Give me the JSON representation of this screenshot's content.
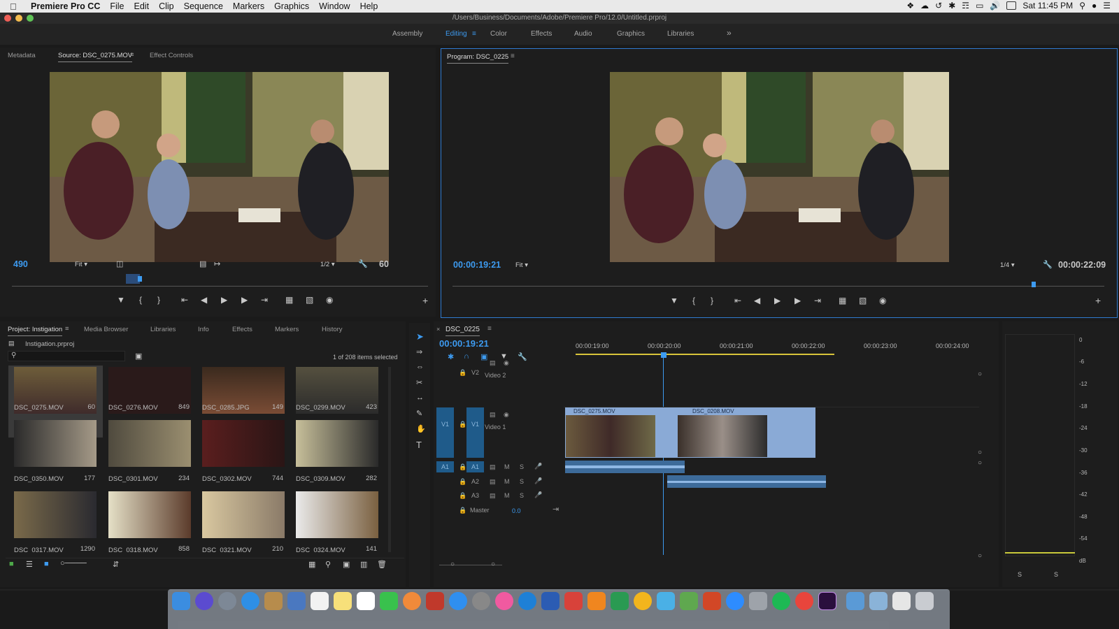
{
  "menubar": {
    "app_name": "Premiere Pro CC",
    "items": [
      "File",
      "Edit",
      "Clip",
      "Sequence",
      "Markers",
      "Graphics",
      "Window",
      "Help"
    ],
    "clock": "Sat 11:45 PM"
  },
  "window": {
    "title": "/Users/Business/Documents/Adobe/Premiere Pro/12.0/Untitled.prproj"
  },
  "workspaces": {
    "tabs": [
      "Assembly",
      "Editing",
      "Color",
      "Effects",
      "Audio",
      "Graphics",
      "Libraries"
    ],
    "active": "Editing",
    "more": "»"
  },
  "source_panel": {
    "tabs": [
      "Metadata",
      "Source: DSC_0275.MOV",
      "Effect Controls"
    ],
    "frame_number": "490",
    "fit": "Fit",
    "resolution": "1/2",
    "duration": "60"
  },
  "program_panel": {
    "title": "Program: DSC_0225",
    "timecode": "00:00:19:21",
    "fit": "Fit",
    "resolution": "1/4",
    "duration": "00:00:22:09"
  },
  "project_panel": {
    "tabs": [
      "Project: Instigation",
      "Media Browser",
      "Libraries",
      "Info",
      "Effects",
      "Markers",
      "History"
    ],
    "file": "Instigation.prproj",
    "selection_count": "1 of 208 items selected",
    "items": [
      {
        "name": "DSC_0275.MOV",
        "count": "60"
      },
      {
        "name": "DSC_0276.MOV",
        "count": "849"
      },
      {
        "name": "DSC_0285.JPG",
        "count": "149"
      },
      {
        "name": "DSC_0299.MOV",
        "count": "423"
      },
      {
        "name": "DSC_0350.MOV",
        "count": "177"
      },
      {
        "name": "DSC_0301.MOV",
        "count": "234"
      },
      {
        "name": "DSC_0302.MOV",
        "count": "744"
      },
      {
        "name": "DSC_0309.MOV",
        "count": "282"
      },
      {
        "name": "DSC_0317.MOV",
        "count": "1290"
      },
      {
        "name": "DSC_0318.MOV",
        "count": "858"
      },
      {
        "name": "DSC_0321.MOV",
        "count": "210"
      },
      {
        "name": "DSC_0324.MOV",
        "count": "141"
      }
    ]
  },
  "timeline": {
    "sequence": "DSC_0225",
    "timecode": "00:00:19:21",
    "ruler": [
      "00:00:19:00",
      "00:00:20:00",
      "00:00:21:00",
      "00:00:22:00",
      "00:00:23:00",
      "00:00:24:00"
    ],
    "tracks": {
      "v2": "V2",
      "v2_name": "Video 2",
      "v1": "V1",
      "v1_name": "Video 1",
      "a1": "A1",
      "a2": "A2",
      "a3": "A3",
      "master": "Master",
      "master_val": "0.0",
      "m": "M",
      "s": "S"
    },
    "clips": {
      "clip1": "DSC_0275.MOV",
      "clip2": "DSC_0208.MOV"
    }
  },
  "audio_meter": {
    "scale": [
      "0",
      "-6",
      "-12",
      "-18",
      "-24",
      "-30",
      "-36",
      "-42",
      "-48",
      "-54",
      "dB"
    ],
    "solo": "S"
  }
}
